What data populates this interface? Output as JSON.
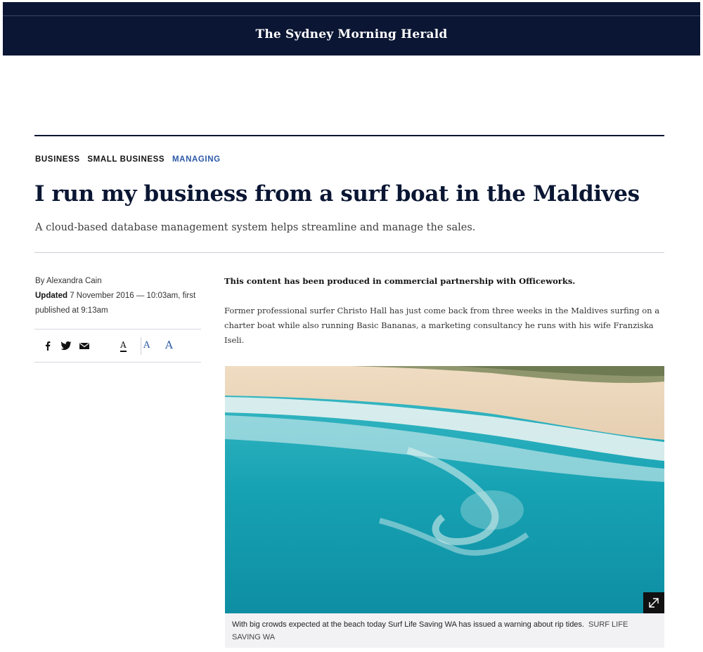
{
  "masthead": {
    "logo": "The Sydney Morning Herald"
  },
  "breadcrumbs": [
    "BUSINESS",
    "SMALL BUSINESS",
    "MANAGING"
  ],
  "article": {
    "headline": "I run my business from a surf boat in the Maldives",
    "standfirst": "A cloud-based database management system helps streamline and manage the sales.",
    "byline": "By Alexandra Cain",
    "updated_label": "Updated",
    "updated_text": "7 November 2016 — 10:03am, first published at 9:13am",
    "disclaimer": "This content has been produced in commercial partnership with Officeworks.",
    "body": "Former professional surfer Christo Hall has just come back from three weeks in the Maldives surfing on a charter boat while also running Basic Bananas, a marketing consultancy he runs with his wife Franziska Iseli."
  },
  "share": {
    "icons": [
      "facebook-icon",
      "twitter-icon",
      "email-icon"
    ],
    "font_sizes": [
      "A",
      "A",
      "A"
    ],
    "selected_font_size": 0
  },
  "photo": {
    "caption": "With big crowds expected at the beach today Surf Life Saving WA has issued a warning about rip tides.",
    "credit": "SURF LIFE SAVING WA"
  },
  "colors": {
    "navy": "#0a1633",
    "accent": "#2d5aa6"
  }
}
